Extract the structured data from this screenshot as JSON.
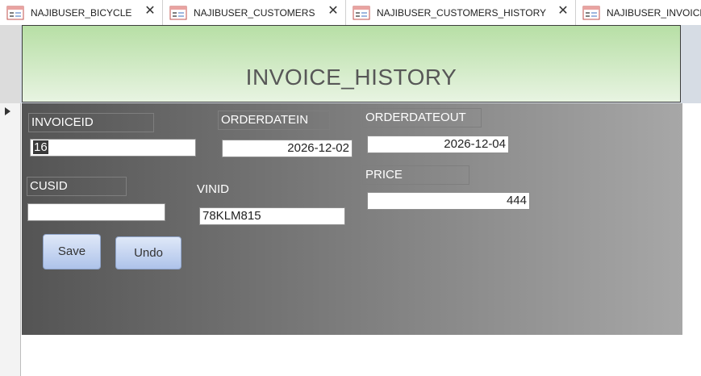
{
  "tabs": [
    {
      "label": "NAJIBUSER_BICYCLE",
      "icon": "form-icon"
    },
    {
      "label": "NAJIBUSER_CUSTOMERS",
      "icon": "form-icon"
    },
    {
      "label": "NAJIBUSER_CUSTOMERS_HISTORY",
      "icon": "form-icon"
    },
    {
      "label": "NAJIBUSER_INVOICE",
      "icon": "form-icon"
    }
  ],
  "form": {
    "title": "INVOICE_HISTORY",
    "fields": {
      "invoiceid": {
        "label": "INVOICEID",
        "value": "16"
      },
      "orderdatein": {
        "label": "ORDERDATEIN",
        "value": "2026-12-02"
      },
      "orderdateout": {
        "label": "ORDERDATEOUT",
        "value": "2026-12-04"
      },
      "cusid": {
        "label": "CUSID",
        "value": ""
      },
      "vinid": {
        "label": "VINID",
        "value": "78KLM815"
      },
      "price": {
        "label": "PRICE",
        "value": "444"
      }
    },
    "buttons": {
      "save": "Save",
      "undo": "Undo"
    }
  },
  "colors": {
    "header_gradient_top": "#b7dfa5",
    "header_gradient_bottom": "#e8f4e2",
    "detail_gradient_left": "#545454",
    "detail_gradient_right": "#a7a7a7",
    "button_top": "#dfe8f8",
    "button_bottom": "#aec3ea"
  }
}
